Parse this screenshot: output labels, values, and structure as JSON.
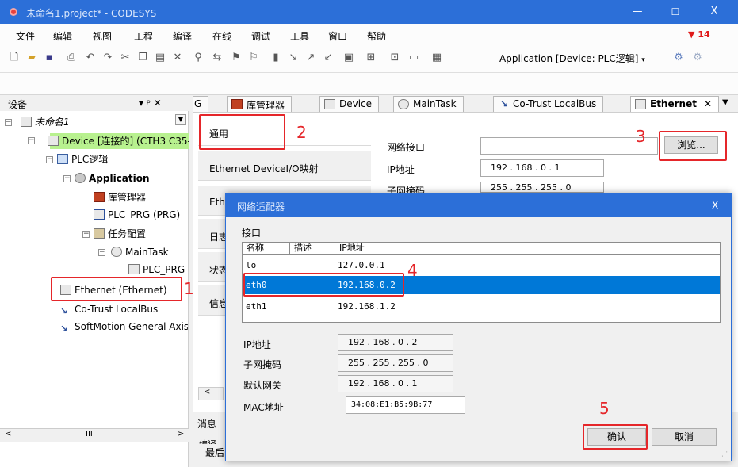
{
  "window": {
    "title": "未命名1.project* - CODESYS",
    "minimize": "—",
    "maximize": "☐",
    "close": "X"
  },
  "menu": [
    "文件",
    "编辑",
    "视图",
    "工程",
    "编译",
    "在线",
    "调试",
    "工具",
    "窗口",
    "帮助"
  ],
  "flag_count": "14",
  "toolbar": {
    "app_select": "Application [Device: PLC逻辑]"
  },
  "devices_panel": {
    "title": "设备",
    "pin": "▾ ᵖ ✕"
  },
  "tree": [
    {
      "label": "未命名1",
      "indent": 0,
      "italic": true
    },
    {
      "label": "Device [连接的] (CTH3 C35-00",
      "indent": 1,
      "highlight": true
    },
    {
      "label": "PLC逻辑",
      "indent": 2
    },
    {
      "label": "Application",
      "indent": 3,
      "bold": true
    },
    {
      "label": "库管理器",
      "indent": 4
    },
    {
      "label": "PLC_PRG (PRG)",
      "indent": 4
    },
    {
      "label": "任务配置",
      "indent": 4
    },
    {
      "label": "MainTask",
      "indent": 5
    },
    {
      "label": "PLC_PRG",
      "indent": 6
    },
    {
      "label": "Ethernet (Ethernet)",
      "indent": 2
    },
    {
      "label": "Co-Trust LocalBus",
      "indent": 2
    },
    {
      "label": "SoftMotion General Axis Po",
      "indent": 2
    }
  ],
  "tabs": [
    "G",
    "库管理器",
    "Device",
    "MainTask",
    "Co-Trust LocalBus",
    "Ethernet"
  ],
  "side_tabs": [
    "通用",
    "Ethernet DeviceI/O映射",
    "Eth",
    "日志",
    "状态",
    "信息"
  ],
  "form": {
    "net_label": "网络接口",
    "ip_label": "IP地址",
    "mask_label": "子网掩码",
    "ip_value": "192  .  168  .   0   .   1",
    "mask_value": "255  .  255  .  255  .   0",
    "browse": "浏览..."
  },
  "dialog": {
    "title": "网络适配器",
    "close": "X",
    "group_label": "接口",
    "columns": [
      "名称",
      "描述",
      "IP地址"
    ],
    "rows": [
      {
        "name": "lo",
        "desc": "",
        "ip": "127.0.0.1"
      },
      {
        "name": "eth0",
        "desc": "",
        "ip": "192.168.0.2",
        "selected": true
      },
      {
        "name": "eth1",
        "desc": "",
        "ip": "192.168.1.2"
      }
    ],
    "ip_label": "IP地址",
    "ip_value": "192  .  168  .   0   .   2",
    "mask_label": "子网掩码",
    "mask_value": "255  .  255  .  255  .   0",
    "gw_label": "默认网关",
    "gw_value": "192  .  168  .   0   .   1",
    "mac_label": "MAC地址",
    "mac_value": "34:08:E1:B5:9B:77",
    "ok": "确认",
    "cancel": "取消"
  },
  "bottom": {
    "messages": "消息",
    "line1": "编译",
    "line2": "最后"
  },
  "annotations": [
    "1",
    "2",
    "3",
    "4",
    "5"
  ]
}
